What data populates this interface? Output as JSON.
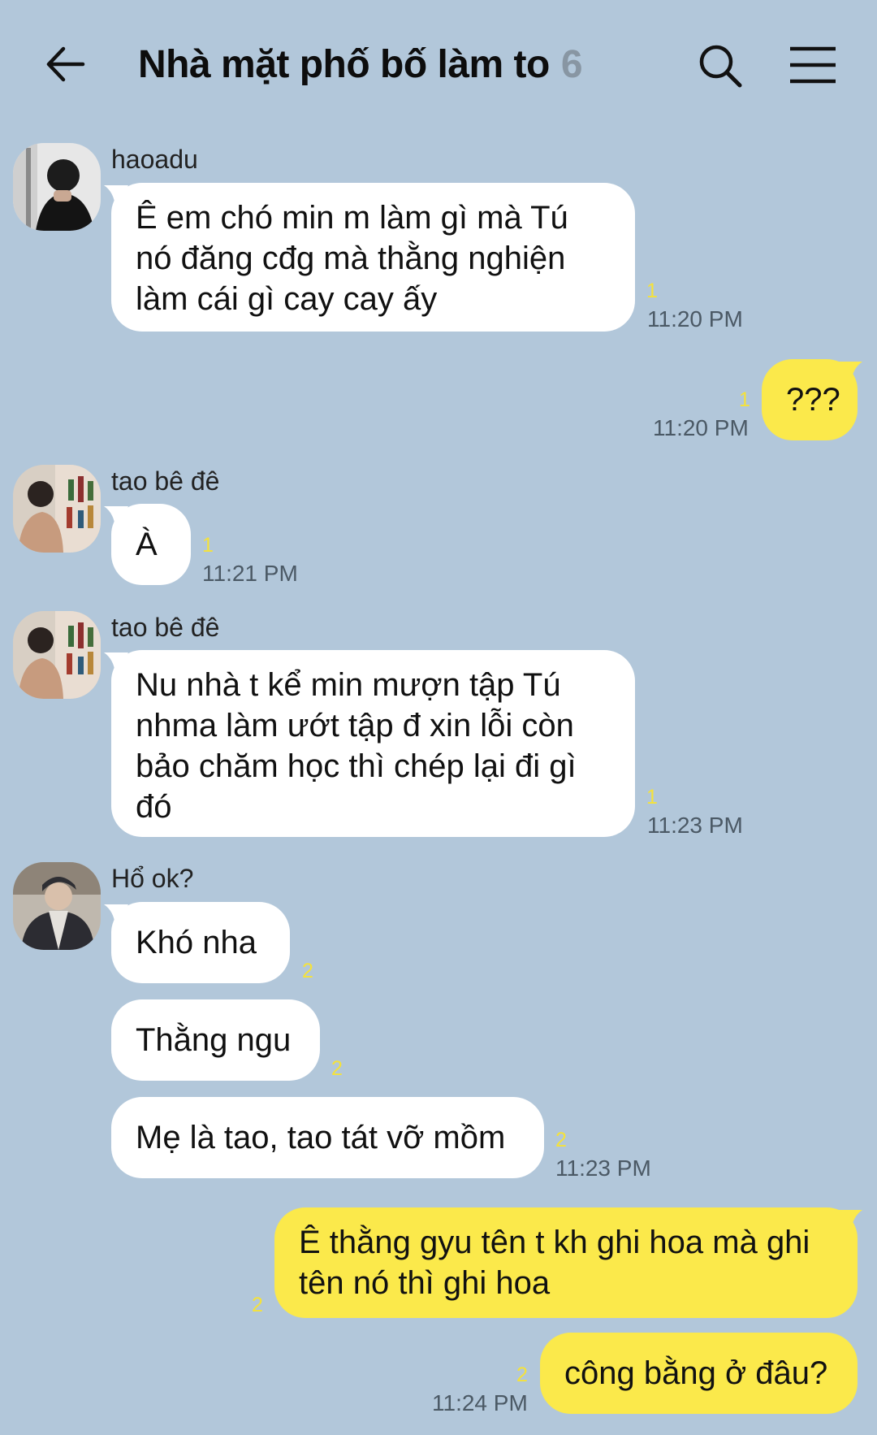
{
  "header": {
    "title": "Nhà mặt phố bố làm to",
    "member_count": "6"
  },
  "icons": {
    "back": "back-arrow-icon",
    "search": "search-icon",
    "menu": "hamburger-menu-icon"
  },
  "colors": {
    "background": "#b2c7da",
    "incoming_bubble": "#ffffff",
    "outgoing_bubble": "#fbe94b",
    "unread_count": "#f5e23a"
  },
  "messages": [
    {
      "sender": "haoadu",
      "text": "Ê em chó min m làm gì mà Tú nó đăng cđg mà thằng nghiện làm cái gì cay cay ấy",
      "unread": "1",
      "time": "11:20 PM"
    },
    {
      "sender": "",
      "text": "???",
      "unread": "1",
      "time": "11:20 PM"
    },
    {
      "sender": "tao bê đê",
      "text": "À",
      "unread": "1",
      "time": "11:21 PM"
    },
    {
      "sender": "tao bê đê",
      "text": "Nu nhà t kể min mượn tập Tú nhma làm ướt tập đ xin lỗi còn bảo chăm học thì chép lại đi gì đó",
      "unread": "1",
      "time": "11:23 PM"
    },
    {
      "sender": "Hổ ok?",
      "text": "Khó nha",
      "unread": "2",
      "time": ""
    },
    {
      "sender": "",
      "text": "Thằng ngu",
      "unread": "2",
      "time": ""
    },
    {
      "sender": "",
      "text": "Mẹ là tao, tao tát vỡ mồm",
      "unread": "2",
      "time": "11:23 PM"
    },
    {
      "sender": "",
      "text": "Ê thằng gyu tên t kh ghi hoa mà ghi tên nó thì ghi hoa",
      "unread": "2",
      "time": ""
    },
    {
      "sender": "",
      "text": "công bằng ở đâu?",
      "unread": "2",
      "time": "11:24 PM"
    }
  ]
}
